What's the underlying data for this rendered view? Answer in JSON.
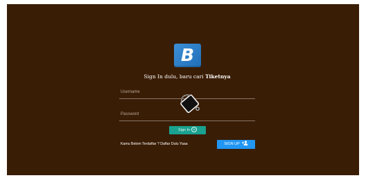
{
  "logo": {
    "letter": "B"
  },
  "tagline": {
    "prefix": "Sign In dulu, baru cari ",
    "bold": "Tiketnya"
  },
  "form": {
    "username_label": "Username",
    "password_label": "Password",
    "signin_label": "Sign In",
    "signin_icon": "arrow-circle-right-icon"
  },
  "register": {
    "text": "Kamu Belom Terdaftar ? Daftar Dulu Yaaa",
    "signup_label": "SIGN UP",
    "signup_icon": "add-user-icon"
  },
  "overlay": {
    "icon": "paint-bucket-icon"
  },
  "colors": {
    "background": "#3a1d05",
    "signin": "#1aa18f",
    "signup": "#2196f3",
    "logo": "#2b7fc9"
  }
}
